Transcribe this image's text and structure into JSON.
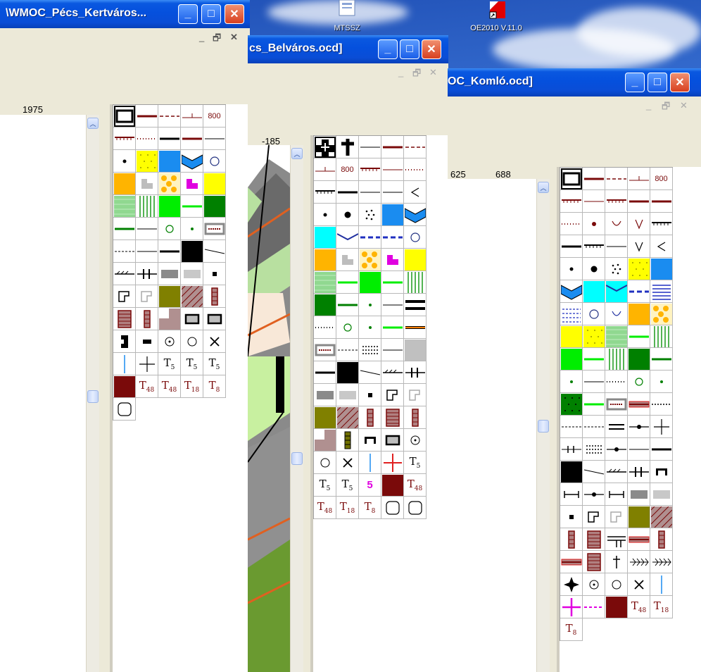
{
  "desktop": {
    "icons": [
      {
        "label": "MTSSZ",
        "icon": "document-icon"
      },
      {
        "label": "OE2010 V.11.0",
        "icon": "oe2010-shortcut-icon"
      }
    ]
  },
  "windows": [
    {
      "id": "kertvaros",
      "title": "\\WMOC_Pécs_Kertváros...",
      "coords": [
        "1975"
      ],
      "palette_layout": "palette_a"
    },
    {
      "id": "belvaros",
      "title": "cs_Belváros.ocd]",
      "coords": [
        "-185"
      ],
      "palette_layout": "palette_b"
    },
    {
      "id": "komlo",
      "title": "OC_Komló.ocd]",
      "coords": [
        "625",
        "688"
      ],
      "palette_layout": "palette_c"
    }
  ],
  "text_symbols": {
    "t5": "T5",
    "t48": "T48",
    "t18": "T18",
    "t8": "T8",
    "five": "5",
    "eight_hundred": "800"
  },
  "colors": {
    "brown": "#7a0a0a",
    "olive": "#808000",
    "blue": "#1a8cf0",
    "yellow": "#ffff00",
    "orange": "#ffb400",
    "green": "#00ee00",
    "darkgreen": "#008000",
    "magenta": "#e000e0",
    "cyan": "#00ffff",
    "red": "#e02020"
  }
}
